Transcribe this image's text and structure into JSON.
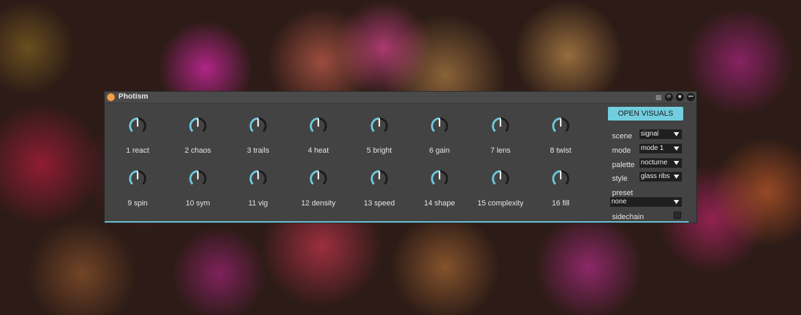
{
  "device": {
    "title": "Photism",
    "accent": "#72cedf",
    "power_color": "#f5a04a",
    "titlebar_icons": [
      "calendar-icon",
      "refresh-icon",
      "save-icon",
      "more-icon"
    ]
  },
  "knobs": [
    {
      "label": "1 react"
    },
    {
      "label": "2 chaos"
    },
    {
      "label": "3 trails"
    },
    {
      "label": "4 heat"
    },
    {
      "label": "5 bright"
    },
    {
      "label": "6 gain"
    },
    {
      "label": "7 lens"
    },
    {
      "label": "8 twist"
    },
    {
      "label": "9 spin"
    },
    {
      "label": "10 sym"
    },
    {
      "label": "11 vig"
    },
    {
      "label": "12 density"
    },
    {
      "label": "13 speed"
    },
    {
      "label": "14 shape"
    },
    {
      "label": "15 complexity"
    },
    {
      "label": "16 fill"
    }
  ],
  "panel": {
    "open_button": "OPEN VISUALS",
    "scene_label": "scene",
    "scene_value": "signal",
    "mode_label": "mode",
    "mode_value": "mode 1",
    "palette_label": "palette",
    "palette_value": "nocturne",
    "style_label": "style",
    "style_value": "glass ribs",
    "preset_label": "preset",
    "preset_value": "none",
    "sidechain_label": "sidechain",
    "sidechain_checked": false
  }
}
